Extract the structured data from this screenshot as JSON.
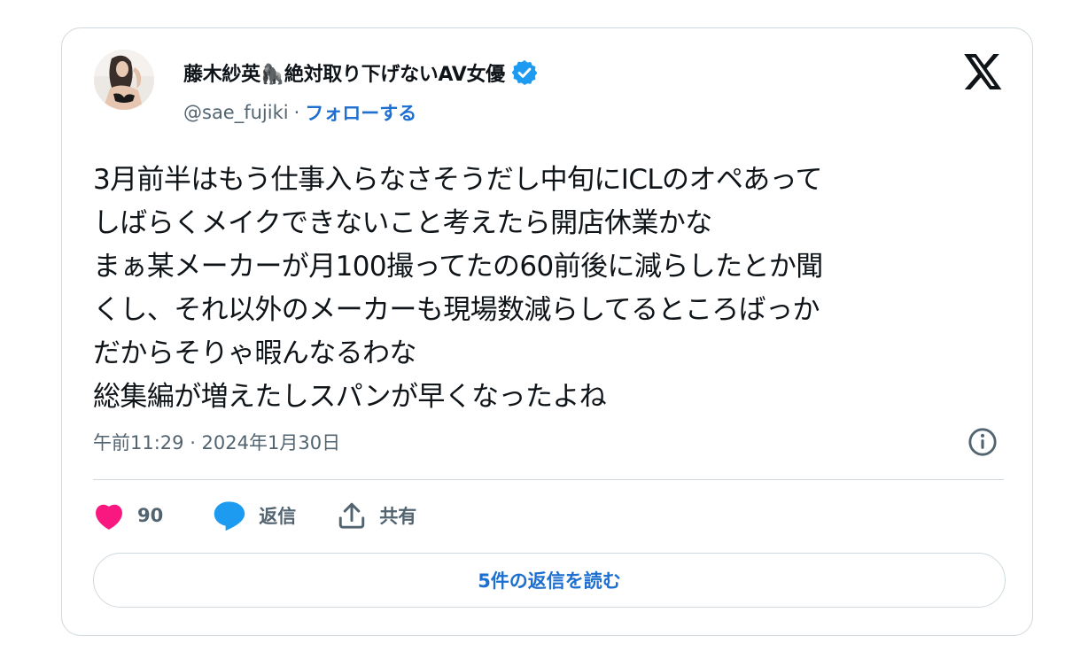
{
  "tweet": {
    "author": {
      "display_name": "藤木紗英🦍絶対取り下げないAV女優",
      "handle": "@sae_fujiki",
      "separator": "·",
      "follow_label": "フォローする",
      "verified": true,
      "avatar": "avatar-photo"
    },
    "lines": [
      "3月前半はもう仕事入らなさそうだし中旬にICLのオペあって",
      "しばらくメイクできないこと考えたら開店休業かな",
      "まぁ某メーカーが月100撮ってたの60前後に減らしたとか聞",
      "くし、それ以外のメーカーも現場数減らしてるところばっか",
      "だからそりゃ暇んなるわな",
      "総集編が増えたしスパンが早くなったよね"
    ],
    "timestamp": "午前11:29 · 2024年1月30日",
    "actions": {
      "like_count": "90",
      "reply_label": "返信",
      "share_label": "共有"
    },
    "read_replies_label": "5件の返信を読む"
  },
  "icons": {
    "brand": "x-logo-icon",
    "verified": "verified-badge-icon",
    "info": "info-icon",
    "like": "heart-icon",
    "reply": "reply-bubble-icon",
    "share": "share-upload-icon"
  },
  "colors": {
    "text_primary": "#0f1419",
    "text_secondary": "#536471",
    "link_blue": "#1d6fd0",
    "verified_blue": "#1d9bf0",
    "like_pink": "#f91880",
    "border": "#cfd9de"
  }
}
